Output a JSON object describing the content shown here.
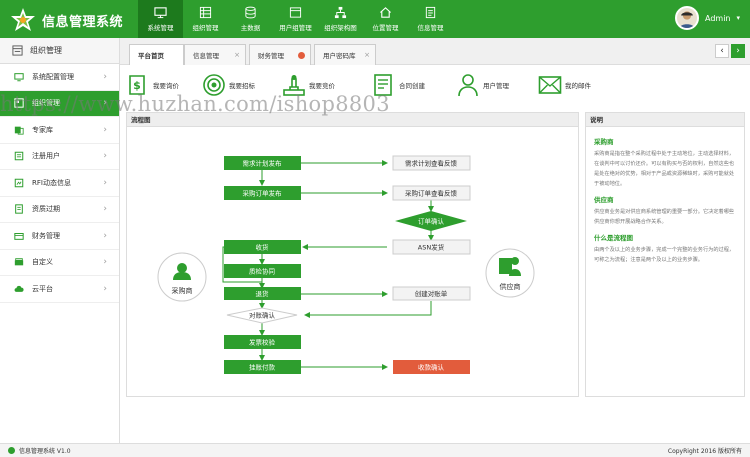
{
  "app": {
    "title": "信息管理系统",
    "user": "Admin"
  },
  "topnav": [
    {
      "label": "系统管理",
      "icon": "monitor-icon"
    },
    {
      "label": "组织管理",
      "icon": "grid-icon"
    },
    {
      "label": "主数据",
      "icon": "database-icon"
    },
    {
      "label": "用户组管理",
      "icon": "window-icon"
    },
    {
      "label": "组织架构图",
      "icon": "org-icon"
    },
    {
      "label": "位置管理",
      "icon": "home-icon"
    },
    {
      "label": "信息管理",
      "icon": "doc-icon"
    }
  ],
  "sidebar": {
    "header": "组织管理",
    "items": [
      {
        "label": "系统配置管理",
        "icon": "monitor-icon"
      },
      {
        "label": "组织管理",
        "icon": "grid-icon"
      },
      {
        "label": "专家库",
        "icon": "people-icon"
      },
      {
        "label": "注册用户",
        "icon": "list-icon"
      },
      {
        "label": "RFI动态信息",
        "icon": "rfi-icon"
      },
      {
        "label": "资质过期",
        "icon": "doc-icon"
      },
      {
        "label": "财务管理",
        "icon": "wallet-icon"
      },
      {
        "label": "自定义",
        "icon": "box-icon"
      },
      {
        "label": "云平台",
        "icon": "cloud-icon"
      }
    ]
  },
  "tabs": [
    {
      "label": "平台首页"
    },
    {
      "label": "信息管理"
    },
    {
      "label": "财务管理"
    },
    {
      "label": "用户密码库"
    }
  ],
  "quick": [
    {
      "label": "我要询价",
      "icon": "dollar-icon"
    },
    {
      "label": "我要招标",
      "icon": "target-icon"
    },
    {
      "label": "我要竞价",
      "icon": "stamp-icon"
    },
    {
      "label": "合同创建",
      "icon": "contract-icon"
    },
    {
      "label": "用户管理",
      "icon": "user-icon"
    },
    {
      "label": "我的邮件",
      "icon": "mail-icon"
    }
  ],
  "watermark": "https://www.huzhan.com/ishop8803",
  "flow": {
    "title": "流程图",
    "buyer": "采购商",
    "supplier": "供应商",
    "nodes": {
      "n1": "需求计划发布",
      "n2": "需求计划查看反馈",
      "n3": "采购订单发布",
      "n4": "采购订单查看反馈",
      "n5": "订单确认",
      "n6": "ASN发货",
      "n7": "收货",
      "n8": "质检协同",
      "n9": "退货",
      "n10": "创建对账单",
      "n11": "对账确认",
      "n12": "发票校验",
      "n13": "挂账付款",
      "n14": "收款确认"
    }
  },
  "desc": {
    "title": "说明",
    "s1": {
      "h": "采购商",
      "p": "采购商是指在整个采购过程中处于主动地位，主动选择材料，在谈判中可以讨价还价。可以有购买与否的权利，自然这些也是处在绝对的优势，相对于产品或资源稀缺时，采购可能就处于被动地位。"
    },
    "s2": {
      "h": "供应商",
      "p": "供应商业务是对供应商系统管理的重要一部分。它决定着哪些供应商你想开展战略合作关系。"
    },
    "s3": {
      "h": "什么是流程图",
      "p": "由两个及以上的业务步骤，完成一个完整的业务行为的过程，可称之为流程；注意是两个及以上的业务步骤。"
    }
  },
  "footer": {
    "left": "信息管理系统 V1.0",
    "right": "CopyRight 2016   版权所有"
  },
  "colors": {
    "accent": "#2e9e2e",
    "dark": "#1d7a1d",
    "red": "#e25c3c"
  }
}
